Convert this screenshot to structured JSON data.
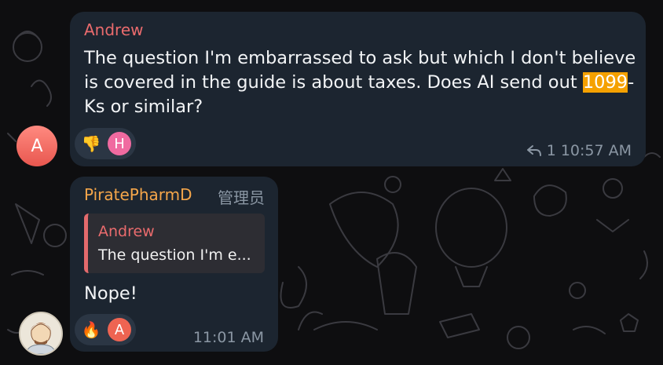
{
  "message1": {
    "sender": "Andrew",
    "avatar_letter": "A",
    "text_before": "The question I'm embarrassed to ask but which I don't believe is covered in the guide is about taxes. Does AI send out ",
    "highlight": "1099",
    "text_after": "-Ks or similar?",
    "reactions": [
      {
        "type": "emoji",
        "icon": "thumbs-down-icon",
        "glyph": "👎"
      },
      {
        "type": "avatar",
        "letter": "H",
        "color": "#f06aa0"
      }
    ],
    "reply_count": "1",
    "time": "10:57 AM"
  },
  "message2": {
    "sender": "PiratePharmD",
    "role": "管理员",
    "reply_to": {
      "name": "Andrew",
      "text": "The question I'm e..."
    },
    "text": "Nope!",
    "reactions": [
      {
        "type": "emoji",
        "icon": "fire-icon",
        "glyph": "🔥"
      },
      {
        "type": "avatar",
        "letter": "A",
        "color": "#ee6452"
      }
    ],
    "time": "11:01 AM"
  },
  "colors": {
    "accent_highlight": "#f5a100",
    "bubble": "#1c2530",
    "andrew": "#ea6b6d",
    "piratepharmd": "#f5a64a"
  }
}
